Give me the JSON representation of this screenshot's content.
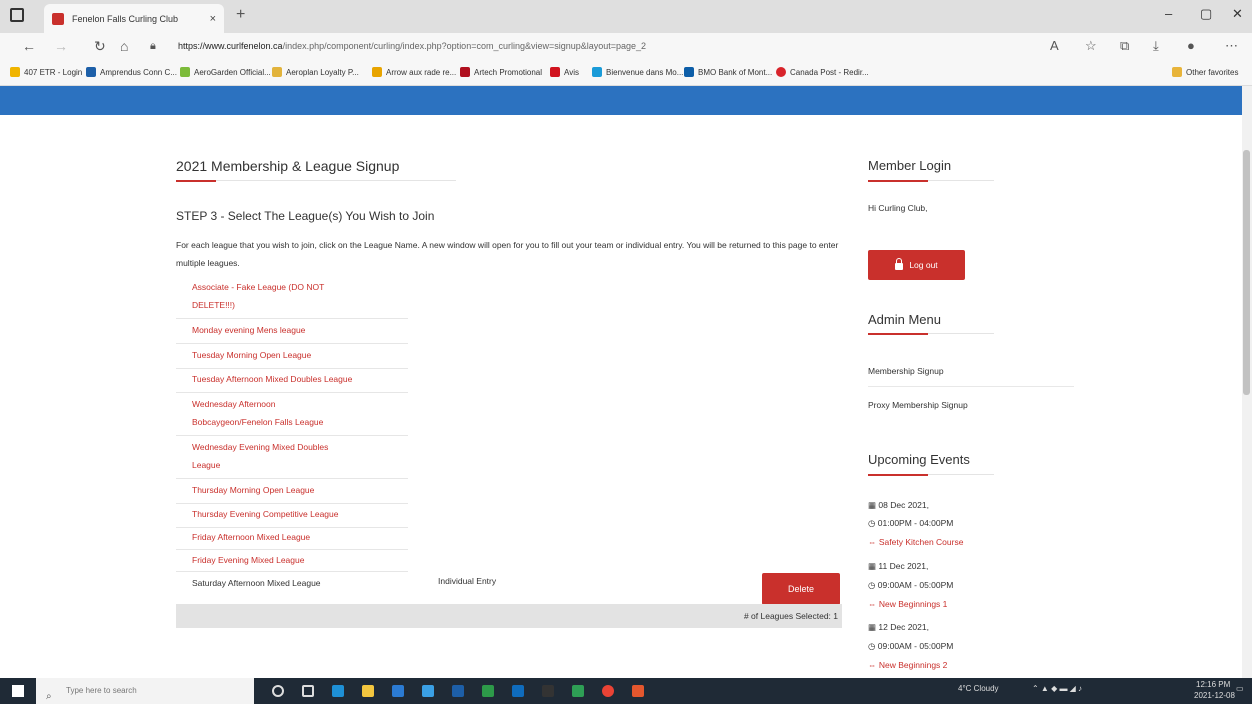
{
  "browser": {
    "tab_title": "Fenelon Falls Curling Club",
    "tab_close": "×",
    "new_tab": "+",
    "url_host": "https://www.curlfenelon.ca",
    "url_path": "/index.php/component/curling/index.php?option=com_curling&view=signup&layout=page_2",
    "favorites": [
      "407 ETR - Login",
      "Amprendus Conn C...",
      "AeroGarden Official...",
      "Aeroplan Loyalty P...",
      "Arrow aux rade re...",
      "Artech Promotional",
      "Avis",
      "Bienvenue dans Mo...",
      "BMO Bank of Mont...",
      "Canada Post - Redir...",
      "Other favorites"
    ]
  },
  "main": {
    "title": "2021 Membership & League Signup",
    "step_title": "STEP 3 - Select The League(s) You Wish to Join",
    "instructions": "For each league that you wish to join, click on the League Name. A new window will open for you to fill out your team or individual entry. You will be returned to this page to enter multiple leagues.",
    "leagues": [
      "Associate - Fake League (DO NOT",
      "DELETE!!!)",
      "Monday evening Mens league",
      "Tuesday Morning Open League",
      "Tuesday Afternoon Mixed Doubles League",
      "Wednesday Afternoon",
      "Bobcaygeon/Fenelon Falls League",
      "Wednesday Evening Mixed Doubles",
      "League",
      "Thursday Morning Open League",
      "Thursday Evening Competitive League",
      "Friday Afternoon Mixed League",
      "Friday Evening Mixed League"
    ],
    "selected_league": "Saturday Afternoon Mixed League",
    "selected_entry": "Individual Entry",
    "delete_label": "Delete",
    "leagues_selected": "# of Leagues Selected: 1"
  },
  "sidebar": {
    "member_login_title": "Member Login",
    "greeting": "Hi Curling Club,",
    "logout_label": "Log out",
    "admin_title": "Admin Menu",
    "admin_items": [
      "Membership Signup",
      "Proxy Membership Signup"
    ],
    "events_title": "Upcoming Events",
    "events": [
      {
        "date": "08 Dec 2021,",
        "time": "01:00PM - 04:00PM",
        "name": "Safety Kitchen Course"
      },
      {
        "date": "11 Dec 2021,",
        "time": "09:00AM - 05:00PM",
        "name": "New Beginnings 1"
      },
      {
        "date": "12 Dec 2021,",
        "time": "09:00AM - 05:00PM",
        "name": "New Beginnings 2"
      }
    ]
  },
  "taskbar": {
    "search_placeholder": "Type here to search",
    "weather": "4°C Cloudy",
    "time": "12:16 PM",
    "date": "2021-12-08"
  },
  "colors": {
    "accent": "#c9302c",
    "header_blue": "#2c72c0"
  }
}
